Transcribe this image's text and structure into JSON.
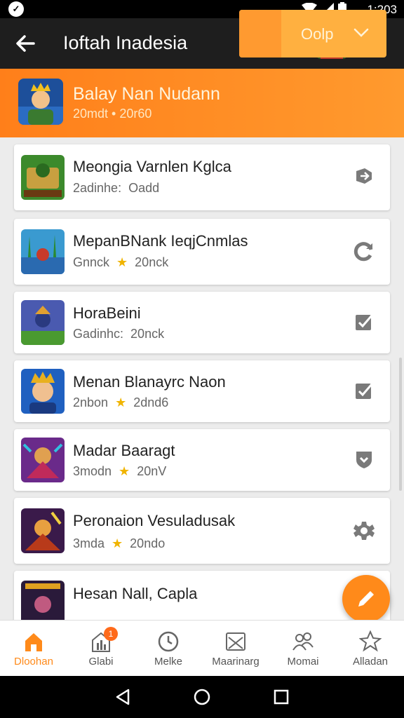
{
  "status_bar": {
    "time": "1:203"
  },
  "app_bar": {
    "title": "Ioftah Inadesia"
  },
  "banner": {
    "name": "Balay Nan Nudann",
    "meta": "20mdt • 20r60",
    "button_label": "Oolp"
  },
  "games": [
    {
      "title": "Meongia Varnlen Kglca",
      "meta_left": "2adinhe:",
      "meta_right": "Oadd",
      "star": false,
      "action_icon": "share-icon"
    },
    {
      "title": "MepanBNank IeqjCnmlas",
      "meta_left": "Gnnck",
      "meta_right": "20nck",
      "star": true,
      "action_icon": "refresh-icon"
    },
    {
      "title": "HoraBeini",
      "meta_left": "Gadinhc:",
      "meta_right": "20nck",
      "star": false,
      "action_icon": "checkbox-icon"
    },
    {
      "title": "Menan Blanayrc Naon",
      "meta_left": "2nbon",
      "meta_right": "2dnd6",
      "star": true,
      "action_icon": "checkbox-icon"
    },
    {
      "title": "Madar Baaragt",
      "meta_left": "3modn",
      "meta_right": "20nV",
      "star": true,
      "action_icon": "shield-icon"
    },
    {
      "title": "Peronaion Vesuladusak",
      "meta_left": "3mda",
      "meta_right": "20ndo",
      "star": true,
      "action_icon": "gear-icon"
    },
    {
      "title": "Hesan Nall, Capla",
      "meta_left": "",
      "meta_right": "",
      "star": false,
      "action_icon": ""
    }
  ],
  "bottom_nav": [
    {
      "label": "Dloohan",
      "icon": "home-icon",
      "active": true
    },
    {
      "label": "Glabi",
      "icon": "stats-icon",
      "badge": "1"
    },
    {
      "label": "Melke",
      "icon": "clock-icon"
    },
    {
      "label": "Maarinarg",
      "icon": "mail-icon"
    },
    {
      "label": "Momai",
      "icon": "people-icon"
    },
    {
      "label": "Alladan",
      "icon": "trophy-icon"
    }
  ],
  "colors": {
    "accent": "#ff8a1a",
    "app_bar": "#1e1e1e"
  }
}
